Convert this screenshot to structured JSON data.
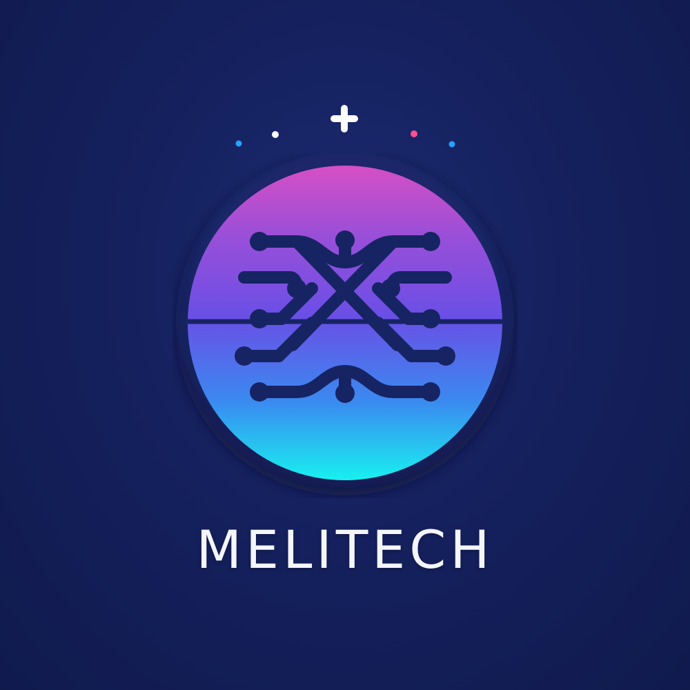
{
  "brand": {
    "name": "MELITECH"
  },
  "colors": {
    "background": "#15215e",
    "gradient_top": "#d64fc4",
    "gradient_mid": "#6a4fe6",
    "gradient_bottom": "#18f0f0",
    "ring": "#172463",
    "circuit": "#172463",
    "sparkle_white": "#ffffff",
    "sparkle_blue": "#2aa0ff",
    "sparkle_pink": "#ff4f8f"
  },
  "icons": {
    "emblem": "circuit-x-emblem-icon",
    "sparkle": "plus-sparkle-icon"
  }
}
